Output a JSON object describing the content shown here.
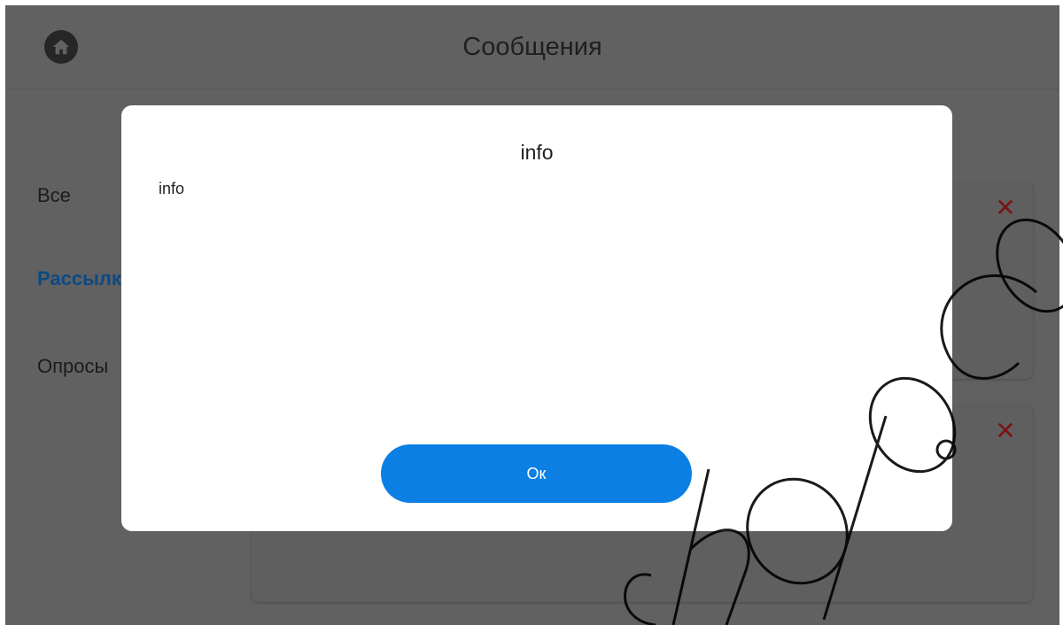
{
  "header": {
    "title": "Сообщения",
    "home_icon": "home-icon"
  },
  "sidebar": {
    "items": [
      {
        "label": "Все",
        "active": false
      },
      {
        "label": "Рассылки",
        "active": true
      },
      {
        "label": "Опросы",
        "active": false
      }
    ]
  },
  "messages": {
    "cards": [
      {
        "delete_icon": "close-icon"
      },
      {
        "delete_icon": "close-icon"
      }
    ]
  },
  "dialog": {
    "title": "info",
    "message": "info",
    "ok_label": "Ок"
  },
  "colors": {
    "overlay_background": "#616161",
    "active_tab": "#0b4a84",
    "primary_button": "#0b7fe4",
    "delete_icon": "#7a1414"
  }
}
